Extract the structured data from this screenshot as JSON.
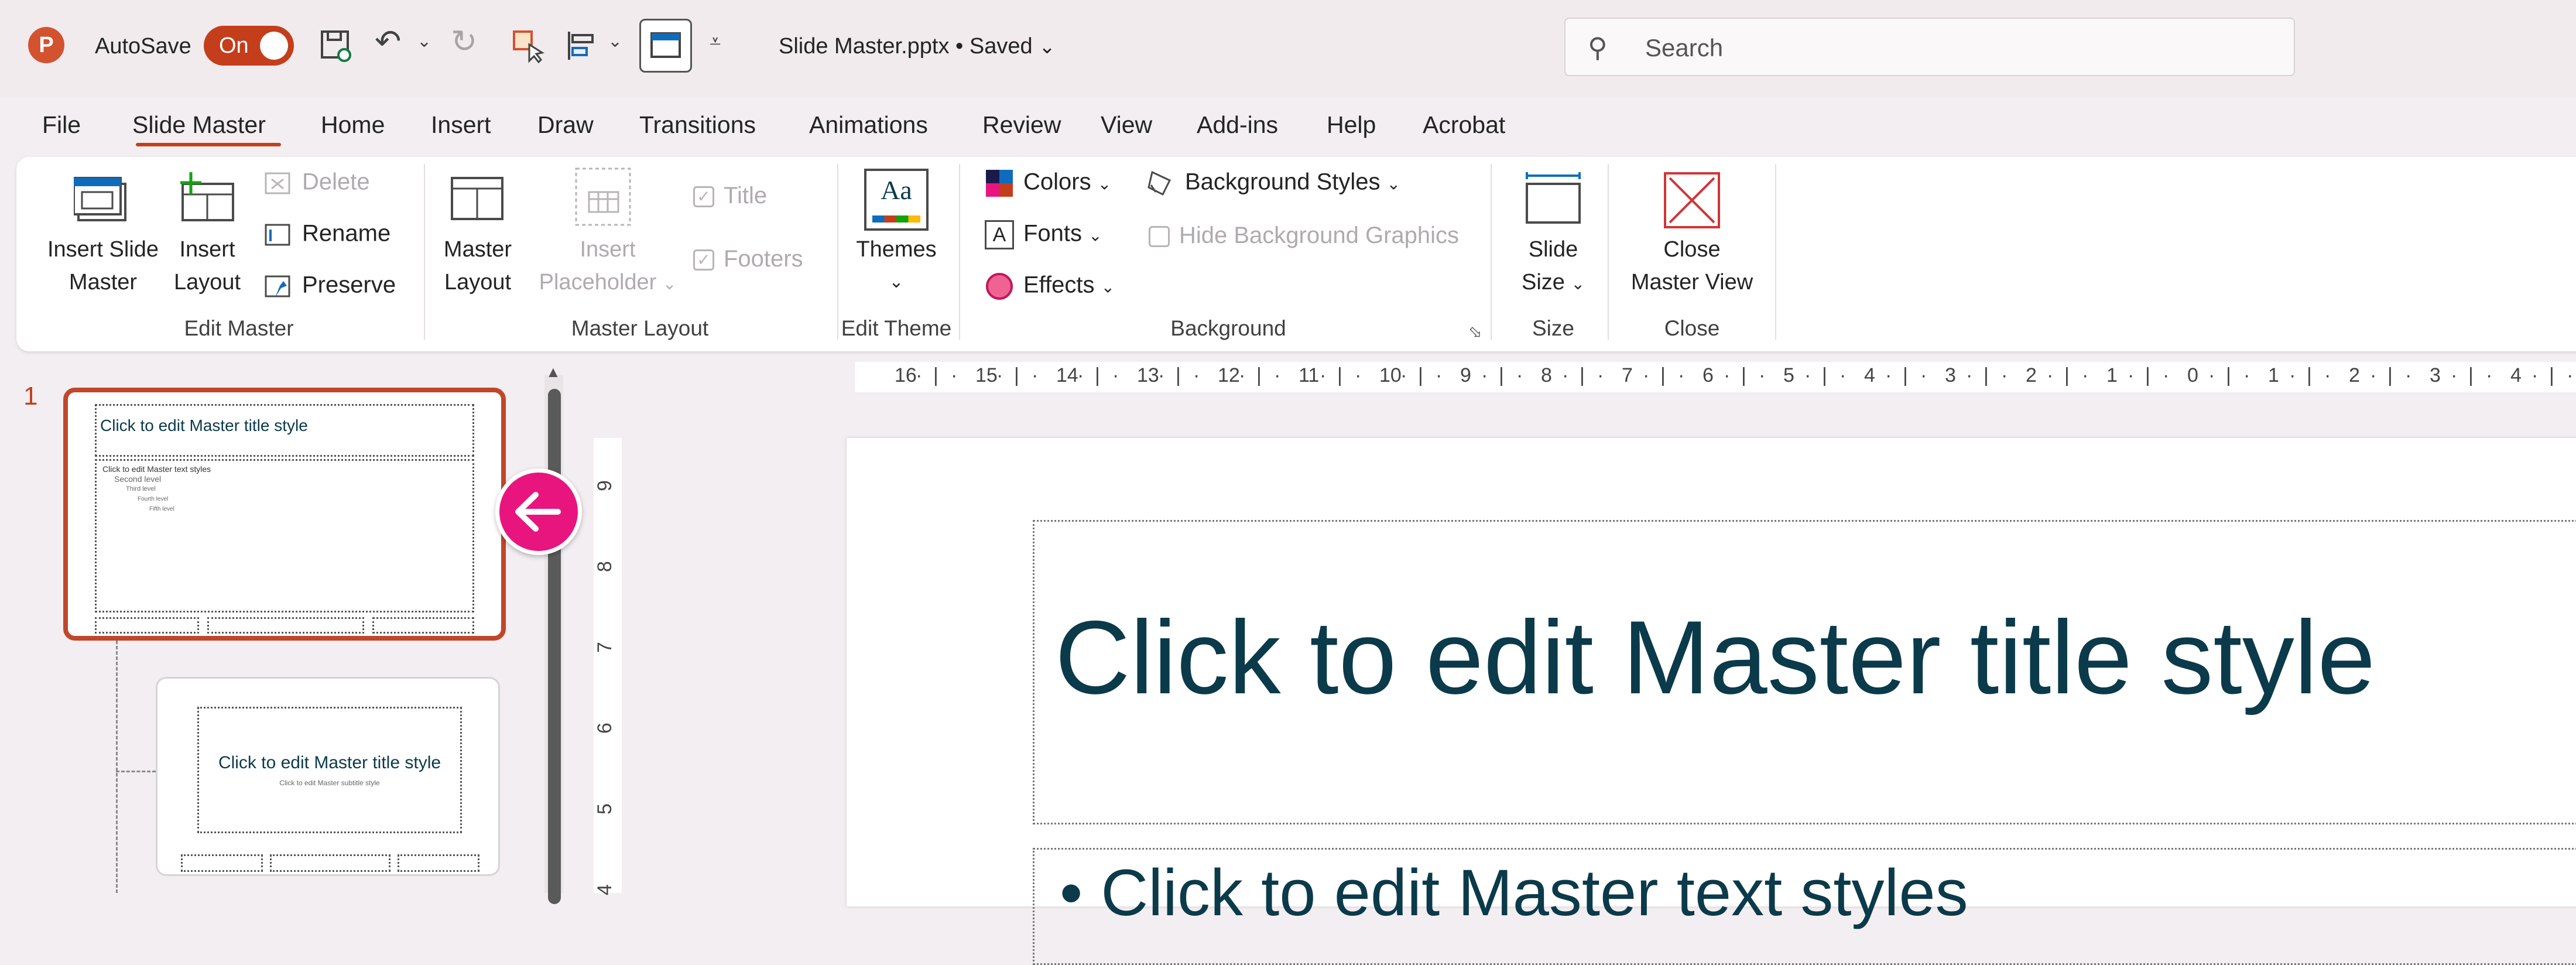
{
  "titlebar": {
    "app_icon": "powerpoint-logo",
    "app_letter": "P",
    "autosave_label": "AutoSave",
    "autosave_state": "On",
    "doc_title": "Slide Master.pptx",
    "save_state": "Saved",
    "search_placeholder": "Search"
  },
  "tabs": [
    "File",
    "Slide Master",
    "Home",
    "Insert",
    "Draw",
    "Transitions",
    "Animations",
    "Review",
    "View",
    "Add-ins",
    "Help",
    "Acrobat"
  ],
  "active_tab": "Slide Master",
  "ribbon": {
    "edit_master": {
      "label": "Edit Master",
      "insert_slide_master": [
        "Insert Slide",
        "Master"
      ],
      "insert_layout": [
        "Insert",
        "Layout"
      ],
      "delete": "Delete",
      "rename": "Rename",
      "preserve": "Preserve"
    },
    "master_layout": {
      "label": "Master Layout",
      "master_layout_btn": [
        "Master",
        "Layout"
      ],
      "insert_placeholder": [
        "Insert",
        "Placeholder"
      ],
      "title": "Title",
      "footers": "Footers"
    },
    "edit_theme": {
      "label": "Edit Theme",
      "themes": "Themes",
      "themes_icon_text": "Aa"
    },
    "background": {
      "label": "Background",
      "colors": "Colors",
      "fonts": "Fonts",
      "effects": "Effects",
      "background_styles": "Background Styles",
      "hide_background_graphics": "Hide Background Graphics"
    },
    "size": {
      "label": "Size",
      "slide_size": [
        "Slide",
        "Size"
      ]
    },
    "close": {
      "label": "Close",
      "close_master_view": [
        "Close",
        "Master View"
      ]
    }
  },
  "thumbnails": {
    "number": "1",
    "master_title": "Click to edit Master title style",
    "master_body": [
      "Click to edit Master text styles",
      "Second level",
      "Third level",
      "Fourth level",
      "Fifth level"
    ],
    "layout_title": "Click to edit Master title style",
    "layout_subtitle": "Click to edit Master subtitle style"
  },
  "ruler": {
    "horizontal": [
      "16",
      "15",
      "14",
      "13",
      "12",
      "11",
      "10",
      "9",
      "8",
      "7",
      "6",
      "5",
      "4",
      "3",
      "2",
      "1",
      "0",
      "1",
      "2",
      "3",
      "4"
    ],
    "vertical": [
      "9",
      "8",
      "7",
      "6",
      "5",
      "4"
    ]
  },
  "slide": {
    "title": "Click to edit Master title style",
    "body_first": "• Click to edit Master text styles"
  },
  "colors": {
    "accent": "#c43e1c",
    "back_button": "#e8157e",
    "title_text": "#0b3a4a"
  }
}
